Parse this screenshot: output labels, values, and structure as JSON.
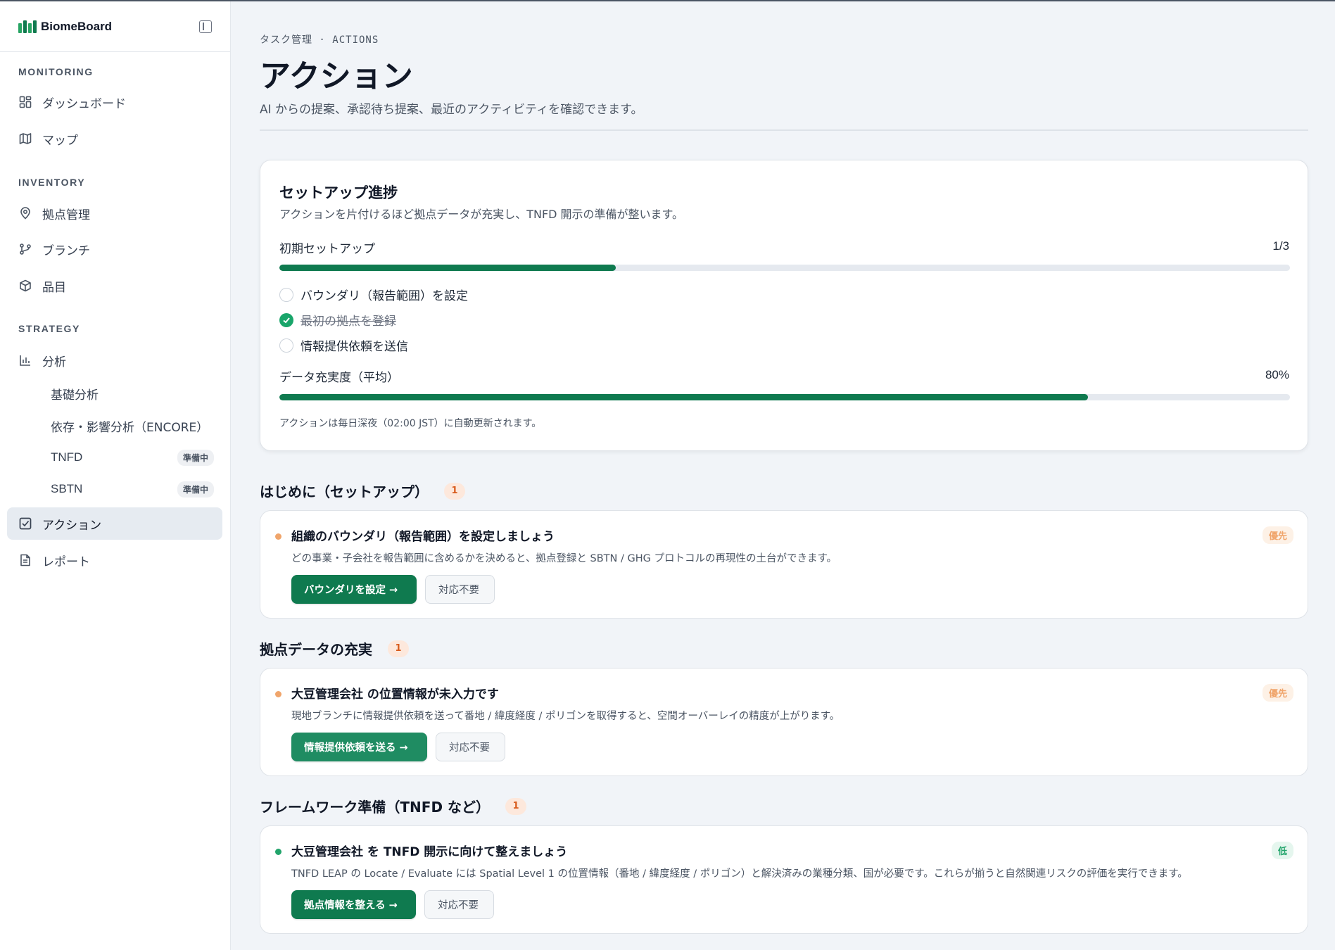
{
  "app": {
    "name": "BiomeBoard"
  },
  "sidebar": {
    "sections": {
      "monitoring": "MONITORING",
      "inventory": "INVENTORY",
      "strategy": "STRATEGY"
    },
    "items": {
      "dashboard": "ダッシュボード",
      "map": "マップ",
      "sites": "拠点管理",
      "branch": "ブランチ",
      "products": "品目",
      "analysis": "分析",
      "basic_analysis": "基礎分析",
      "encore": "依存・影響分析（ENCORE）",
      "tnfd": "TNFD",
      "sbtn": "SBTN",
      "actions": "アクション",
      "reports": "レポート"
    },
    "badge_prep": "準備中"
  },
  "header": {
    "breadcrumb": "タスク管理 · ACTIONS",
    "title": "アクション",
    "subtitle": "AI からの提案、承認待ち提案、最近のアクティビティを確認できます。"
  },
  "progress": {
    "title": "セットアップ進捗",
    "subtitle": "アクションを片付けるほど拠点データが充実し、TNFD 開示の準備が整います。",
    "initial_label": "初期セットアップ",
    "initial_value": "1/3",
    "initial_fraction": 0.333,
    "checklist": [
      {
        "label": "バウンダリ（報告範囲）を設定",
        "done": false
      },
      {
        "label": "最初の拠点を登録",
        "done": true
      },
      {
        "label": "情報提供依頼を送信",
        "done": false
      }
    ],
    "completeness_label": "データ充実度（平均）",
    "completeness_value": "80%",
    "completeness_fraction": 0.8,
    "note": "アクションは毎日深夜（02:00 JST）に自動更新されます。"
  },
  "sections": [
    {
      "heading": "はじめに（セットアップ）",
      "count": "1",
      "card": {
        "title": "組織のバウンダリ（報告範囲）を設定しましょう",
        "description": "どの事業・子会社を報告範囲に含めるかを決めると、拠点登録と SBTN / GHG プロトコルの再現性の土台ができます。",
        "tag": "優先",
        "primary": "バウンダリを設定 →",
        "secondary": "対応不要",
        "dot_color": "#f0a56b"
      }
    },
    {
      "heading": "拠点データの充実",
      "count": "1",
      "card": {
        "title": "大豆管理会社 の位置情報が未入力です",
        "description": "現地ブランチに情報提供依頼を送って番地 / 緯度経度 / ポリゴンを取得すると、空間オーバーレイの精度が上がります。",
        "tag": "優先",
        "primary": "情報提供依頼を送る →",
        "secondary": "対応不要",
        "dot_color": "#f0a56b"
      }
    },
    {
      "heading": "フレームワーク準備（TNFD など）",
      "count": "1",
      "card": {
        "title": "大豆管理会社 を TNFD 開示に向けて整えましょう",
        "description": "TNFD LEAP の Locate / Evaluate には Spatial Level 1 の位置情報（番地 / 緯度経度 / ポリゴン）と解決済みの業種分類、国が必要です。これらが揃うと自然関連リスクの評価を実行できます。",
        "tag": "低",
        "primary": "拠点情報を整える →",
        "secondary": "対応不要",
        "dot_color": "#22a46b"
      }
    }
  ]
}
